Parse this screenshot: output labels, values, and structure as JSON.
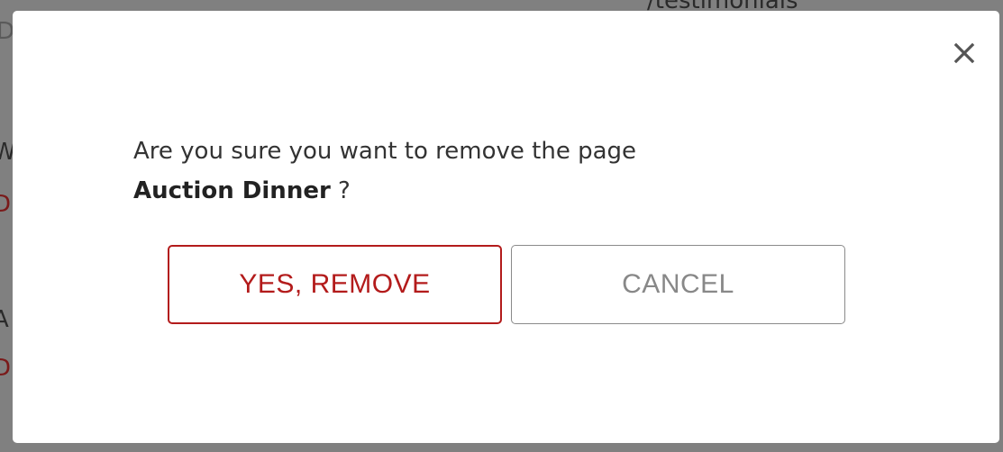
{
  "background": {
    "top_text": "/testimonials",
    "left_fragments": [
      "D",
      "W",
      "D",
      "A",
      "D"
    ]
  },
  "dialog": {
    "close_icon": "close-icon",
    "message_prefix": "Are you sure you want to remove the page",
    "page_name": "Auction Dinner",
    "message_suffix": " ?",
    "confirm_label": "YES, REMOVE",
    "cancel_label": "CANCEL"
  },
  "colors": {
    "overlay": "#808080",
    "danger": "#b31b1b",
    "neutral_border": "#8a8a8a",
    "neutral_text": "#888888"
  }
}
